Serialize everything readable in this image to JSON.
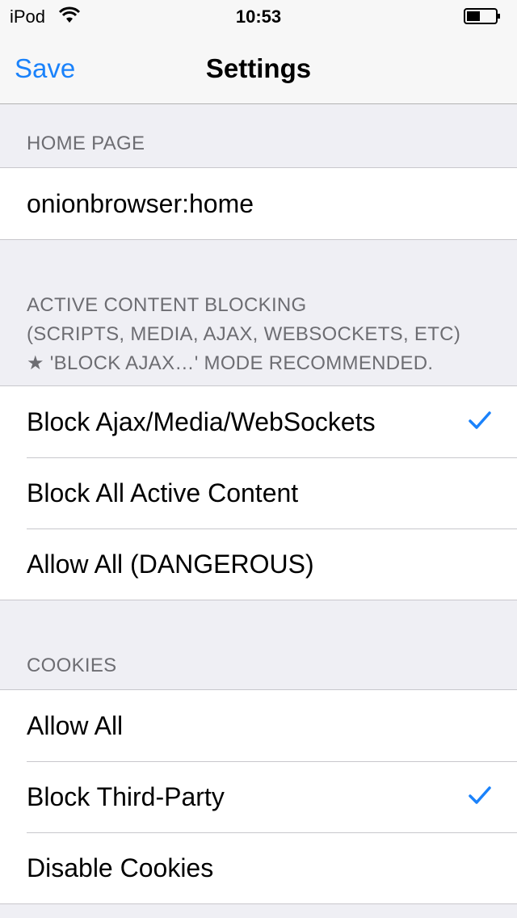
{
  "status_bar": {
    "carrier": "iPod",
    "time": "10:53"
  },
  "nav": {
    "save_label": "Save",
    "title": "Settings"
  },
  "home_page": {
    "header": "HOME PAGE",
    "value": "onionbrowser:home"
  },
  "active_content": {
    "header_lines": [
      "ACTIVE CONTENT BLOCKING",
      "(SCRIPTS, MEDIA, AJAX, WEBSOCKETS, ETC)",
      "★ 'BLOCK AJAX…' MODE RECOMMENDED."
    ],
    "options": [
      {
        "label": "Block Ajax/Media/WebSockets",
        "checked": true
      },
      {
        "label": "Block All Active Content",
        "checked": false
      },
      {
        "label": "Allow All (DANGEROUS)",
        "checked": false
      }
    ]
  },
  "cookies": {
    "header": "COOKIES",
    "options": [
      {
        "label": "Allow All",
        "checked": false
      },
      {
        "label": "Block Third-Party",
        "checked": true
      },
      {
        "label": "Disable Cookies",
        "checked": false
      }
    ]
  },
  "colors": {
    "accent": "#1a82fb",
    "background": "#efeff4",
    "header_text": "#6d6d72"
  },
  "icons": {
    "wifi": "wifi-icon",
    "battery": "battery-icon",
    "check": "checkmark-icon"
  }
}
